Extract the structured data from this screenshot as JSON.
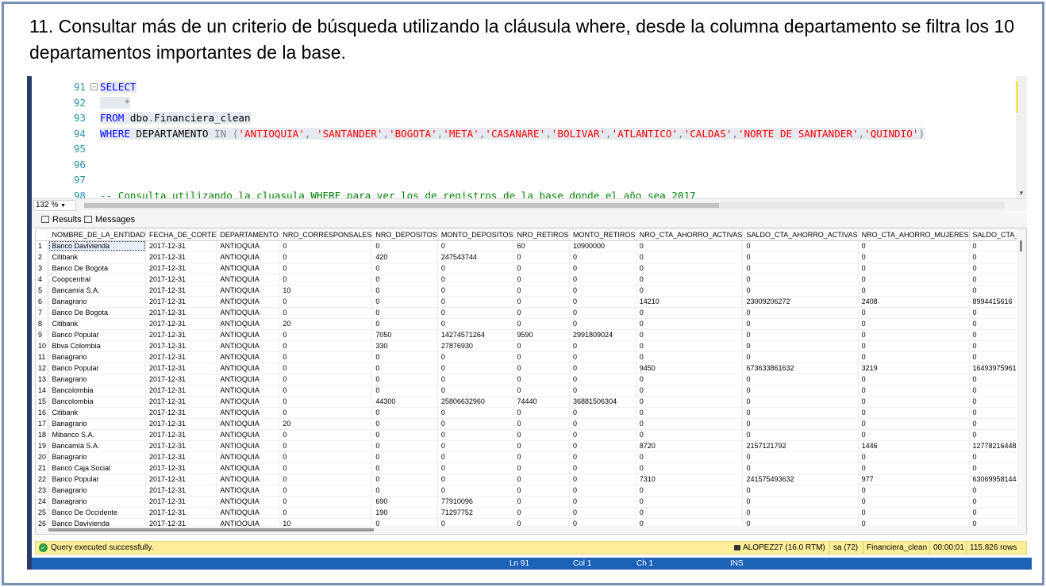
{
  "slide": {
    "title": "11. Consultar más de un criterio de búsqueda utilizando la cláusula where, desde la columna departamento se filtra los 10 departamentos importantes de la base."
  },
  "editor": {
    "lines": [
      {
        "num": "91",
        "parts": [
          {
            "t": "SELECT",
            "c": "kw"
          }
        ]
      },
      {
        "num": "92",
        "parts": [
          {
            "t": "    *",
            "c": "gray"
          }
        ]
      },
      {
        "num": "93",
        "parts": [
          {
            "t": "FROM",
            "c": "kw"
          },
          {
            "t": " dbo",
            "c": "plain"
          },
          {
            "t": ".",
            "c": "gray"
          },
          {
            "t": "Financiera_clean",
            "c": "plain"
          }
        ]
      },
      {
        "num": "94",
        "parts": [
          {
            "t": "WHERE",
            "c": "kw"
          },
          {
            "t": " DEPARTAMENTO ",
            "c": "plain"
          },
          {
            "t": "IN",
            "c": "gray"
          },
          {
            "t": " (",
            "c": "gray"
          },
          {
            "t": "'ANTIOQUIA'",
            "c": "str"
          },
          {
            "t": ", ",
            "c": "gray"
          },
          {
            "t": "'SANTANDER'",
            "c": "str"
          },
          {
            "t": ",",
            "c": "gray"
          },
          {
            "t": "'BOGOTA'",
            "c": "str"
          },
          {
            "t": ",",
            "c": "gray"
          },
          {
            "t": "'META'",
            "c": "str"
          },
          {
            "t": ",",
            "c": "gray"
          },
          {
            "t": "'CASANARE'",
            "c": "str"
          },
          {
            "t": ",",
            "c": "gray"
          },
          {
            "t": "'BOLIVAR'",
            "c": "str"
          },
          {
            "t": ",",
            "c": "gray"
          },
          {
            "t": "'ATLANTICO'",
            "c": "str"
          },
          {
            "t": ",",
            "c": "gray"
          },
          {
            "t": "'CALDAS'",
            "c": "str"
          },
          {
            "t": ",",
            "c": "gray"
          },
          {
            "t": "'NORTE DE SANTANDER'",
            "c": "str"
          },
          {
            "t": ",",
            "c": "gray"
          },
          {
            "t": "'QUINDIO'",
            "c": "str"
          },
          {
            "t": ")",
            "c": "gray"
          }
        ]
      },
      {
        "num": "95",
        "parts": []
      },
      {
        "num": "96",
        "parts": []
      },
      {
        "num": "97",
        "parts": []
      },
      {
        "num": "98",
        "parts": [
          {
            "t": "-- Consulta utilizando la cluasula WHERE para ver los de registros de la base donde el año sea 2017",
            "c": "cmt"
          }
        ]
      }
    ],
    "zoom": "132 %"
  },
  "tabs": {
    "results": "Results",
    "messages": "Messages"
  },
  "grid": {
    "columns": [
      "NOMBRE_DE_LA_ENTIDAD",
      "FECHA_DE_CORTE",
      "DEPARTAMENTO",
      "NRO_CORRESPONSALES",
      "NRO_DEPOSITOS",
      "MONTO_DEPOSITOS",
      "NRO_RETIROS",
      "MONTO_RETIROS",
      "NRO_CTA_AHORRO_ACTIVAS",
      "SALDO_CTA_AHORRO_ACTIVAS",
      "NRO_CTA_AHORRO_MUJERES",
      "SALDO_CTA_A"
    ],
    "rows": [
      [
        "1",
        "Banco Davivienda",
        "2017-12-31",
        "ANTIOQUIA",
        "0",
        "0",
        "0",
        "60",
        "10900000",
        "0",
        "0",
        "0",
        "0"
      ],
      [
        "2",
        "Citibank",
        "2017-12-31",
        "ANTIOQUIA",
        "0",
        "420",
        "247543744",
        "0",
        "0",
        "0",
        "0",
        "0",
        "0"
      ],
      [
        "3",
        "Banco De Bogota",
        "2017-12-31",
        "ANTIOQUIA",
        "0",
        "0",
        "0",
        "0",
        "0",
        "0",
        "0",
        "0",
        "0"
      ],
      [
        "4",
        "Coopcentral",
        "2017-12-31",
        "ANTIOQUIA",
        "0",
        "0",
        "0",
        "0",
        "0",
        "0",
        "0",
        "0",
        "0"
      ],
      [
        "5",
        "Bancamía S.A.",
        "2017-12-31",
        "ANTIOQUIA",
        "10",
        "0",
        "0",
        "0",
        "0",
        "0",
        "0",
        "0",
        "0"
      ],
      [
        "6",
        "Banagrario",
        "2017-12-31",
        "ANTIOQUIA",
        "0",
        "0",
        "0",
        "0",
        "0",
        "14210",
        "23009206272",
        "2408",
        "8994415616"
      ],
      [
        "7",
        "Banco De Bogota",
        "2017-12-31",
        "ANTIOQUIA",
        "0",
        "0",
        "0",
        "0",
        "0",
        "0",
        "0",
        "0",
        "0"
      ],
      [
        "8",
        "Citibank",
        "2017-12-31",
        "ANTIOQUIA",
        "20",
        "0",
        "0",
        "0",
        "0",
        "0",
        "0",
        "0",
        "0"
      ],
      [
        "9",
        "Banco Popular",
        "2017-12-31",
        "ANTIOQUIA",
        "0",
        "7050",
        "14274571264",
        "9590",
        "2991809024",
        "0",
        "0",
        "0",
        "0"
      ],
      [
        "10",
        "Bbva Colombia",
        "2017-12-31",
        "ANTIOQUIA",
        "0",
        "330",
        "27876930",
        "0",
        "0",
        "0",
        "0",
        "0",
        "0"
      ],
      [
        "11",
        "Banagrario",
        "2017-12-31",
        "ANTIOQUIA",
        "0",
        "0",
        "0",
        "0",
        "0",
        "0",
        "0",
        "0",
        "0"
      ],
      [
        "12",
        "Banco Popular",
        "2017-12-31",
        "ANTIOQUIA",
        "0",
        "0",
        "0",
        "0",
        "0",
        "9450",
        "673633861632",
        "3219",
        "16493975961"
      ],
      [
        "13",
        "Banagrario",
        "2017-12-31",
        "ANTIOQUIA",
        "0",
        "0",
        "0",
        "0",
        "0",
        "0",
        "0",
        "0",
        "0"
      ],
      [
        "14",
        "Bancolombia",
        "2017-12-31",
        "ANTIOQUIA",
        "0",
        "0",
        "0",
        "0",
        "0",
        "0",
        "0",
        "0",
        "0"
      ],
      [
        "15",
        "Bancolombia",
        "2017-12-31",
        "ANTIOQUIA",
        "0",
        "44300",
        "25806632960",
        "74440",
        "36881506304",
        "0",
        "0",
        "0",
        "0"
      ],
      [
        "16",
        "Citibank",
        "2017-12-31",
        "ANTIOQUIA",
        "0",
        "0",
        "0",
        "0",
        "0",
        "0",
        "0",
        "0",
        "0"
      ],
      [
        "17",
        "Banagrario",
        "2017-12-31",
        "ANTIOQUIA",
        "20",
        "0",
        "0",
        "0",
        "0",
        "0",
        "0",
        "0",
        "0"
      ],
      [
        "18",
        "Mibanco S.A.",
        "2017-12-31",
        "ANTIOQUIA",
        "0",
        "0",
        "0",
        "0",
        "0",
        "0",
        "0",
        "0",
        "0"
      ],
      [
        "19",
        "Bancamía S.A.",
        "2017-12-31",
        "ANTIOQUIA",
        "0",
        "0",
        "0",
        "0",
        "0",
        "8720",
        "2157121792",
        "1446",
        "12778216448"
      ],
      [
        "20",
        "Banagrario",
        "2017-12-31",
        "ANTIOQUIA",
        "0",
        "0",
        "0",
        "0",
        "0",
        "0",
        "0",
        "0",
        "0"
      ],
      [
        "21",
        "Banco Caja Social",
        "2017-12-31",
        "ANTIOQUIA",
        "0",
        "0",
        "0",
        "0",
        "0",
        "0",
        "0",
        "0",
        "0"
      ],
      [
        "22",
        "Banco Popular",
        "2017-12-31",
        "ANTIOQUIA",
        "0",
        "0",
        "0",
        "0",
        "0",
        "7310",
        "241575493632",
        "977",
        "63069958144"
      ],
      [
        "23",
        "Banagrario",
        "2017-12-31",
        "ANTIOQUIA",
        "0",
        "0",
        "0",
        "0",
        "0",
        "0",
        "0",
        "0",
        "0"
      ],
      [
        "24",
        "Banagrario",
        "2017-12-31",
        "ANTIOQUIA",
        "0",
        "690",
        "77910096",
        "0",
        "0",
        "0",
        "0",
        "0",
        "0"
      ],
      [
        "25",
        "Banco De Occidente",
        "2017-12-31",
        "ANTIOQUIA",
        "0",
        "190",
        "71297752",
        "0",
        "0",
        "0",
        "0",
        "0",
        "0"
      ],
      [
        "26",
        "Banco Davivienda",
        "2017-12-31",
        "ANTIOQUIA",
        "10",
        "0",
        "0",
        "0",
        "0",
        "0",
        "0",
        "0",
        "0"
      ]
    ]
  },
  "status": {
    "message": "Query executed successfully.",
    "server": "ALOPEZ27 (16.0 RTM)",
    "user": "sa (72)",
    "database": "Financiera_clean",
    "time": "00:00:01",
    "rows": "115.826 rows"
  },
  "bottombar": {
    "ln": "Ln 91",
    "col": "Col 1",
    "ch": "Ch 1",
    "ins": "INS"
  },
  "colors": {
    "keyword": "#0000ff",
    "string": "#ff0000",
    "comment": "#008000",
    "status_bg": "#ffef9a",
    "bottombar_bg": "#1c63b7"
  }
}
